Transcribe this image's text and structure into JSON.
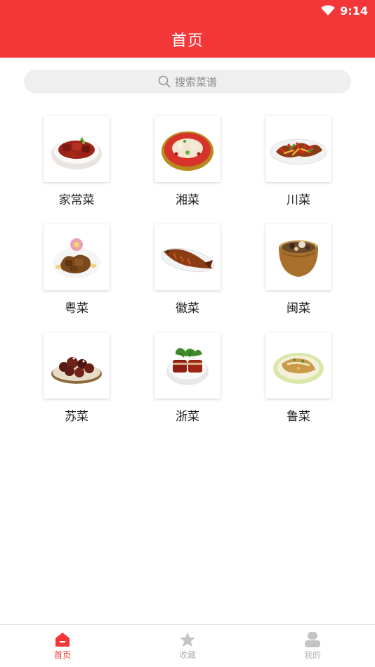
{
  "status_bar": {
    "time": "9:14"
  },
  "header": {
    "title": "首页"
  },
  "search": {
    "placeholder": "搜索菜谱"
  },
  "categories": [
    {
      "label": "家常菜",
      "icon": "braised-pork-bowl-image"
    },
    {
      "label": "湘菜",
      "icon": "spicy-fish-platter-image"
    },
    {
      "label": "川菜",
      "icon": "stir-fried-peppers-image"
    },
    {
      "label": "粤菜",
      "icon": "roast-goose-platter-image"
    },
    {
      "label": "徽菜",
      "icon": "braised-fish-image"
    },
    {
      "label": "闽菜",
      "icon": "buddha-jumps-wall-pot-image"
    },
    {
      "label": "苏菜",
      "icon": "sweet-sour-ribs-image"
    },
    {
      "label": "浙菜",
      "icon": "dongpo-pork-image"
    },
    {
      "label": "鲁菜",
      "icon": "steamed-fish-plate-image"
    }
  ],
  "bottom_nav": [
    {
      "label": "首页",
      "icon": "home-icon",
      "active": true
    },
    {
      "label": "收藏",
      "icon": "star-icon",
      "active": false
    },
    {
      "label": "我的",
      "icon": "user-icon",
      "active": false
    }
  ],
  "colors": {
    "primary": "#f33637",
    "inactive": "#b5b5b5",
    "search_bg": "#efefef"
  }
}
